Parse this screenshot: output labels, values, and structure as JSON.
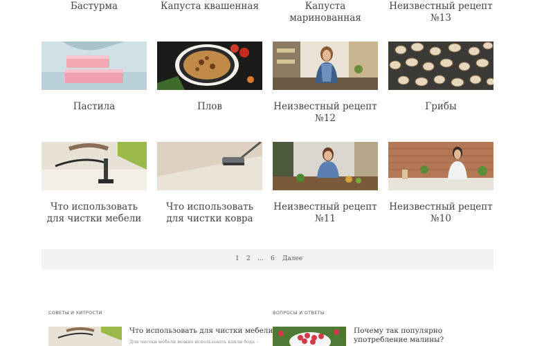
{
  "top_row": [
    {
      "title": "Бастурма"
    },
    {
      "title": "Капуста квашенная"
    },
    {
      "title": "Капуста маринованная"
    },
    {
      "title": "Неизвестный рецепт №13"
    }
  ],
  "row2": [
    {
      "title": "Пастила",
      "image": "pastila-image"
    },
    {
      "title": "Плов",
      "image": "plov-image"
    },
    {
      "title": "Неизвестный рецепт №12",
      "image": "woman-kitchen-image"
    },
    {
      "title": "Грибы",
      "image": "mushrooms-image"
    }
  ],
  "row3": [
    {
      "title": "Что использовать для чистки мебели",
      "image": "sofa-vacuum-image"
    },
    {
      "title": "Что использовать для чистки ковра",
      "image": "carpet-vacuum-image"
    },
    {
      "title": "Неизвестный рецепт №11",
      "image": "woman-cooking-image"
    },
    {
      "title": "Неизвестный рецепт №10",
      "image": "woman-brick-kitchen-image"
    }
  ],
  "pagination": {
    "p1": "1",
    "p2": "2",
    "ellipsis": "...",
    "p6": "6",
    "next": "Далее"
  },
  "tips": {
    "heading": "Советы и хитрости",
    "title": "Что использовать для чистки мебели",
    "excerpt": "Для чистки мебели можно использовать капли бода –"
  },
  "qa": {
    "heading": "Вопросы и ответы",
    "title": "Почему так популярно употребление малины?"
  }
}
